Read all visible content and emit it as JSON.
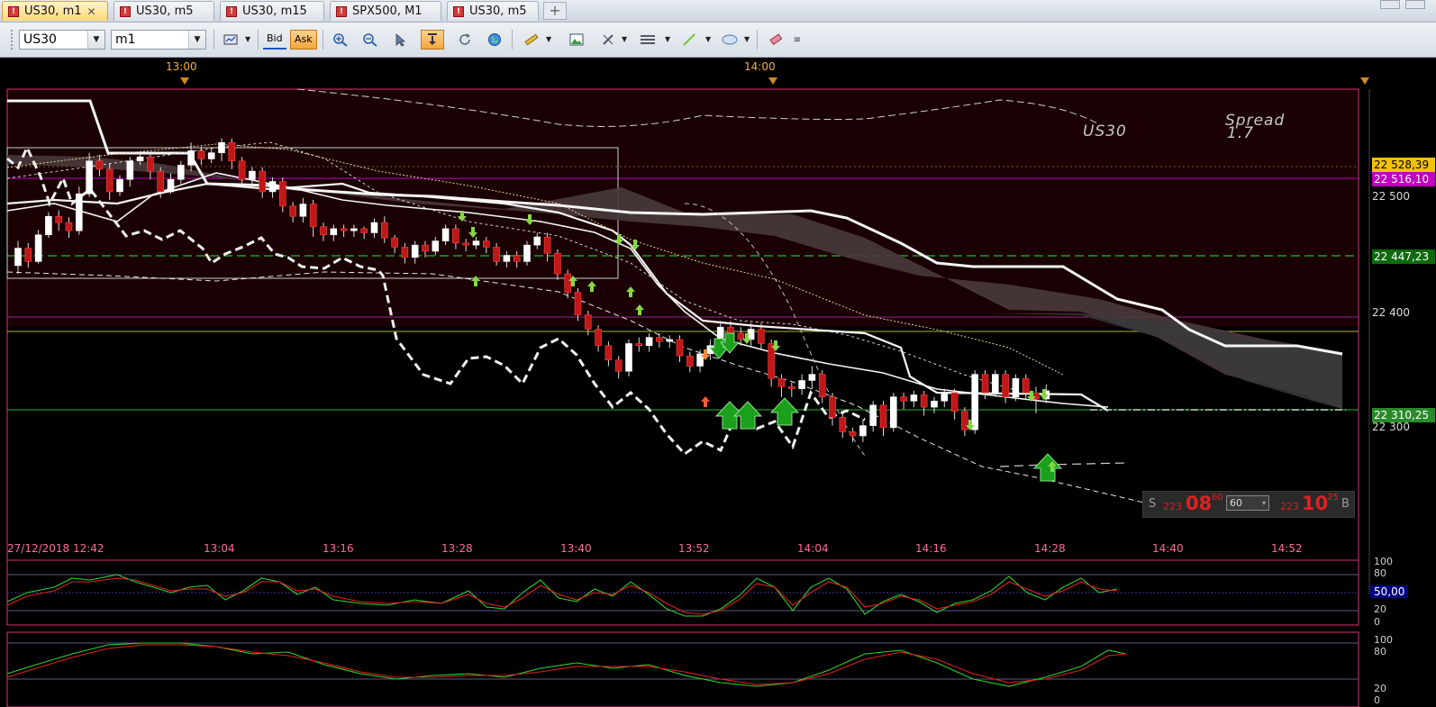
{
  "tabs": [
    {
      "label": "US30, m1",
      "active": true,
      "closable": true
    },
    {
      "label": "US30, m5",
      "active": false,
      "closable": false
    },
    {
      "label": "US30, m15",
      "active": false,
      "closable": false
    },
    {
      "label": "SPX500, M1",
      "active": false,
      "closable": false
    },
    {
      "label": "US30, m5",
      "active": false,
      "closable": false
    }
  ],
  "tab_add_label": "+",
  "tab_icon_text": "!",
  "toolbar": {
    "symbol": "US30",
    "timeframe": "m1",
    "bid_label": "Bid",
    "ask_label": "Ask"
  },
  "time_top": [
    "13:00",
    "14:00"
  ],
  "overlay": {
    "symbol": "US30",
    "spread_label": "Spread",
    "spread_value": "1.7"
  },
  "y_axis_labels": [
    "22 500",
    "22 400",
    "22 300"
  ],
  "price_tags": [
    {
      "text": "22 528,39",
      "bg": "#f2c200",
      "fg": "#000000"
    },
    {
      "text": "22 516,10",
      "bg": "#c000c0",
      "fg": "#ffffff"
    },
    {
      "text": "22 447,23",
      "bg": "#0d6b0d",
      "fg": "#ffffff"
    },
    {
      "text": "22 310,25",
      "bg": "#2a8a2a",
      "fg": "#ffffff"
    }
  ],
  "x_axis_labels": [
    "27/12/2018 12:42",
    "13:04",
    "13:16",
    "13:28",
    "13:40",
    "13:52",
    "14:04",
    "14:16",
    "14:28",
    "14:40",
    "14:52"
  ],
  "spread_panel": {
    "sell_letter": "S",
    "sell_small": "223",
    "sell_big": "08",
    "sell_sup": "60",
    "qty": "60",
    "buy_small": "223",
    "buy_big": "10",
    "buy_sup": "25",
    "buy_letter": "B"
  },
  "osc1": {
    "labels": [
      "100",
      "80",
      "50,00",
      "20",
      "0"
    ]
  },
  "osc2": {
    "labels": [
      "100",
      "80",
      "20",
      "0"
    ]
  },
  "colors": {
    "bull": "#ffffff",
    "bear": "#c01818",
    "accent": "#e0307a",
    "grid": "#ff3c8c"
  },
  "chart_data": {
    "type": "candlestick",
    "y_range": [
      22190,
      22600
    ],
    "candles": [
      [
        22428,
        22445,
        22420,
        22452
      ],
      [
        22445,
        22432,
        22426,
        22450
      ],
      [
        22432,
        22458,
        22430,
        22463
      ],
      [
        22458,
        22476,
        22455,
        22480
      ],
      [
        22476,
        22470,
        22462,
        22482
      ],
      [
        22470,
        22462,
        22455,
        22475
      ],
      [
        22462,
        22498,
        22458,
        22505
      ],
      [
        22498,
        22530,
        22495,
        22538
      ],
      [
        22530,
        22522,
        22515,
        22536
      ],
      [
        22522,
        22500,
        22492,
        22528
      ],
      [
        22500,
        22512,
        22496,
        22516
      ],
      [
        22512,
        22530,
        22505,
        22534
      ],
      [
        22530,
        22534,
        22526,
        22538
      ],
      [
        22534,
        22520,
        22512,
        22538
      ],
      [
        22520,
        22500,
        22494,
        22524
      ],
      [
        22500,
        22512,
        22498,
        22518
      ],
      [
        22512,
        22526,
        22508,
        22530
      ],
      [
        22526,
        22540,
        22520,
        22548
      ],
      [
        22540,
        22532,
        22526,
        22544
      ],
      [
        22532,
        22538,
        22528,
        22542
      ],
      [
        22538,
        22548,
        22530,
        22552
      ],
      [
        22548,
        22530,
        22522,
        22552
      ],
      [
        22530,
        22512,
        22505,
        22534
      ],
      [
        22512,
        22520,
        22506,
        22524
      ],
      [
        22520,
        22500,
        22494,
        22524
      ],
      [
        22500,
        22510,
        22494,
        22514
      ],
      [
        22510,
        22486,
        22480,
        22514
      ],
      [
        22486,
        22476,
        22470,
        22490
      ],
      [
        22476,
        22488,
        22470,
        22494
      ],
      [
        22488,
        22466,
        22456,
        22492
      ],
      [
        22466,
        22458,
        22452,
        22470
      ],
      [
        22458,
        22464,
        22452,
        22468
      ],
      [
        22464,
        22462,
        22456,
        22468
      ],
      [
        22462,
        22464,
        22456,
        22468
      ],
      [
        22464,
        22460,
        22454,
        22466
      ],
      [
        22460,
        22470,
        22455,
        22474
      ],
      [
        22470,
        22455,
        22450,
        22476
      ],
      [
        22455,
        22446,
        22440,
        22458
      ],
      [
        22446,
        22436,
        22430,
        22450
      ],
      [
        22436,
        22448,
        22430,
        22452
      ],
      [
        22448,
        22442,
        22436,
        22452
      ],
      [
        22442,
        22452,
        22438,
        22456
      ],
      [
        22452,
        22464,
        22448,
        22468
      ],
      [
        22464,
        22450,
        22444,
        22468
      ],
      [
        22450,
        22448,
        22442,
        22454
      ],
      [
        22448,
        22452,
        22444,
        22456
      ],
      [
        22452,
        22446,
        22440,
        22456
      ],
      [
        22446,
        22432,
        22428,
        22450
      ],
      [
        22432,
        22438,
        22426,
        22442
      ],
      [
        22438,
        22432,
        22426,
        22442
      ],
      [
        22432,
        22448,
        22428,
        22452
      ],
      [
        22448,
        22456,
        22444,
        22460
      ],
      [
        22456,
        22440,
        22432,
        22460
      ],
      [
        22440,
        22420,
        22414,
        22444
      ],
      [
        22420,
        22402,
        22396,
        22424
      ],
      [
        22402,
        22380,
        22374,
        22406
      ],
      [
        22380,
        22366,
        22360,
        22384
      ],
      [
        22366,
        22350,
        22344,
        22370
      ],
      [
        22350,
        22336,
        22330,
        22354
      ],
      [
        22336,
        22325,
        22318,
        22340
      ],
      [
        22325,
        22352,
        22320,
        22356
      ],
      [
        22352,
        22350,
        22344,
        22358
      ],
      [
        22350,
        22358,
        22344,
        22362
      ],
      [
        22358,
        22354,
        22348,
        22362
      ],
      [
        22354,
        22356,
        22348,
        22360
      ],
      [
        22356,
        22340,
        22334,
        22360
      ],
      [
        22340,
        22330,
        22324,
        22344
      ],
      [
        22330,
        22342,
        22324,
        22346
      ],
      [
        22342,
        22350,
        22336,
        22356
      ],
      [
        22350,
        22368,
        22346,
        22374
      ],
      [
        22368,
        22362,
        22354,
        22374
      ],
      [
        22362,
        22356,
        22350,
        22368
      ],
      [
        22356,
        22366,
        22350,
        22372
      ],
      [
        22366,
        22352,
        22346,
        22372
      ],
      [
        22352,
        22318,
        22310,
        22356
      ],
      [
        22318,
        22310,
        22300,
        22322
      ],
      [
        22310,
        22308,
        22300,
        22314
      ],
      [
        22308,
        22316,
        22302,
        22322
      ],
      [
        22316,
        22322,
        22308,
        22330
      ],
      [
        22322,
        22300,
        22294,
        22326
      ],
      [
        22300,
        22280,
        22272,
        22304
      ],
      [
        22280,
        22266,
        22260,
        22284
      ],
      [
        22266,
        22262,
        22256,
        22270
      ],
      [
        22262,
        22272,
        22256,
        22278
      ],
      [
        22272,
        22292,
        22266,
        22296
      ],
      [
        22292,
        22270,
        22262,
        22296
      ],
      [
        22270,
        22300,
        22266,
        22304
      ],
      [
        22300,
        22296,
        22288,
        22304
      ],
      [
        22296,
        22302,
        22290,
        22306
      ],
      [
        22302,
        22290,
        22282,
        22306
      ],
      [
        22290,
        22296,
        22284,
        22300
      ],
      [
        22296,
        22304,
        22290,
        22308
      ],
      [
        22304,
        22286,
        22278,
        22308
      ],
      [
        22286,
        22268,
        22262,
        22290
      ],
      [
        22268,
        22322,
        22264,
        22326
      ],
      [
        22322,
        22304,
        22298,
        22326
      ],
      [
        22304,
        22322,
        22300,
        22326
      ],
      [
        22322,
        22300,
        22294,
        22326
      ],
      [
        22300,
        22318,
        22296,
        22322
      ],
      [
        22318,
        22304,
        22298,
        22322
      ],
      [
        22304,
        22298,
        22284,
        22310
      ],
      [
        22298,
        22306,
        22294,
        22312
      ]
    ]
  }
}
